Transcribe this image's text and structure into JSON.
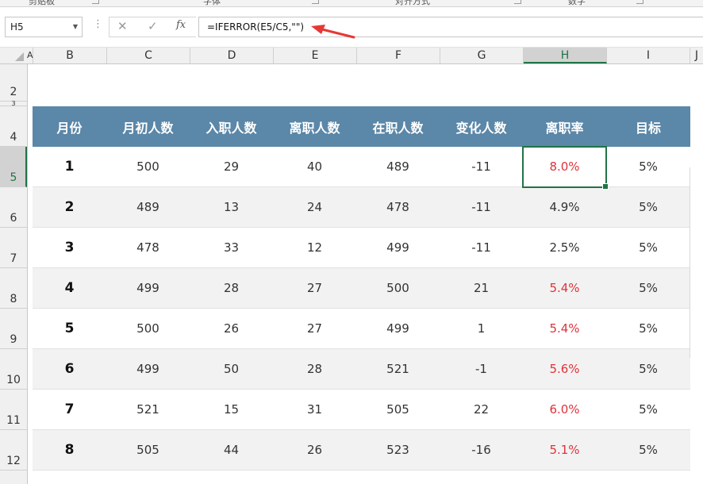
{
  "ribbon": {
    "groups": [
      {
        "label": "剪贴板"
      },
      {
        "label": "字体"
      },
      {
        "label": "对齐方式"
      },
      {
        "label": "数字"
      }
    ]
  },
  "formula_bar": {
    "name_box": "H5",
    "formula": "=IFERROR(E5/C5,\"\")",
    "icons": [
      "cancel-icon",
      "enter-icon",
      "function-icon"
    ]
  },
  "columns": [
    "A",
    "B",
    "C",
    "D",
    "E",
    "F",
    "G",
    "H",
    "I",
    "J"
  ],
  "selected_column": "H",
  "rows": [
    "2",
    "3",
    "4",
    "5",
    "6",
    "7",
    "8",
    "9",
    "10",
    "11",
    "12"
  ],
  "selected_row": "5",
  "table": {
    "headers": [
      "月份",
      "月初人数",
      "入职人数",
      "离职人数",
      "在职人数",
      "变化人数",
      "离职率",
      "目标"
    ],
    "rows": [
      {
        "month": "1",
        "start": "500",
        "hired": "29",
        "left": "40",
        "current": "489",
        "change": "-11",
        "rate": "8.0%",
        "target": "5%",
        "over": true
      },
      {
        "month": "2",
        "start": "489",
        "hired": "13",
        "left": "24",
        "current": "478",
        "change": "-11",
        "rate": "4.9%",
        "target": "5%",
        "over": false
      },
      {
        "month": "3",
        "start": "478",
        "hired": "33",
        "left": "12",
        "current": "499",
        "change": "-11",
        "rate": "2.5%",
        "target": "5%",
        "over": false
      },
      {
        "month": "4",
        "start": "499",
        "hired": "28",
        "left": "27",
        "current": "500",
        "change": "21",
        "rate": "5.4%",
        "target": "5%",
        "over": true
      },
      {
        "month": "5",
        "start": "500",
        "hired": "26",
        "left": "27",
        "current": "499",
        "change": "1",
        "rate": "5.4%",
        "target": "5%",
        "over": true
      },
      {
        "month": "6",
        "start": "499",
        "hired": "50",
        "left": "28",
        "current": "521",
        "change": "-1",
        "rate": "5.6%",
        "target": "5%",
        "over": true
      },
      {
        "month": "7",
        "start": "521",
        "hired": "15",
        "left": "31",
        "current": "505",
        "change": "22",
        "rate": "6.0%",
        "target": "5%",
        "over": true
      },
      {
        "month": "8",
        "start": "505",
        "hired": "44",
        "left": "26",
        "current": "523",
        "change": "-16",
        "rate": "5.1%",
        "target": "5%",
        "over": true
      }
    ]
  },
  "colors": {
    "header_bg": "#5b87a8",
    "alt_row_bg": "#f2f2f2",
    "over_target": "#e0323a",
    "selection": "#217346",
    "arrow": "#e53935"
  }
}
